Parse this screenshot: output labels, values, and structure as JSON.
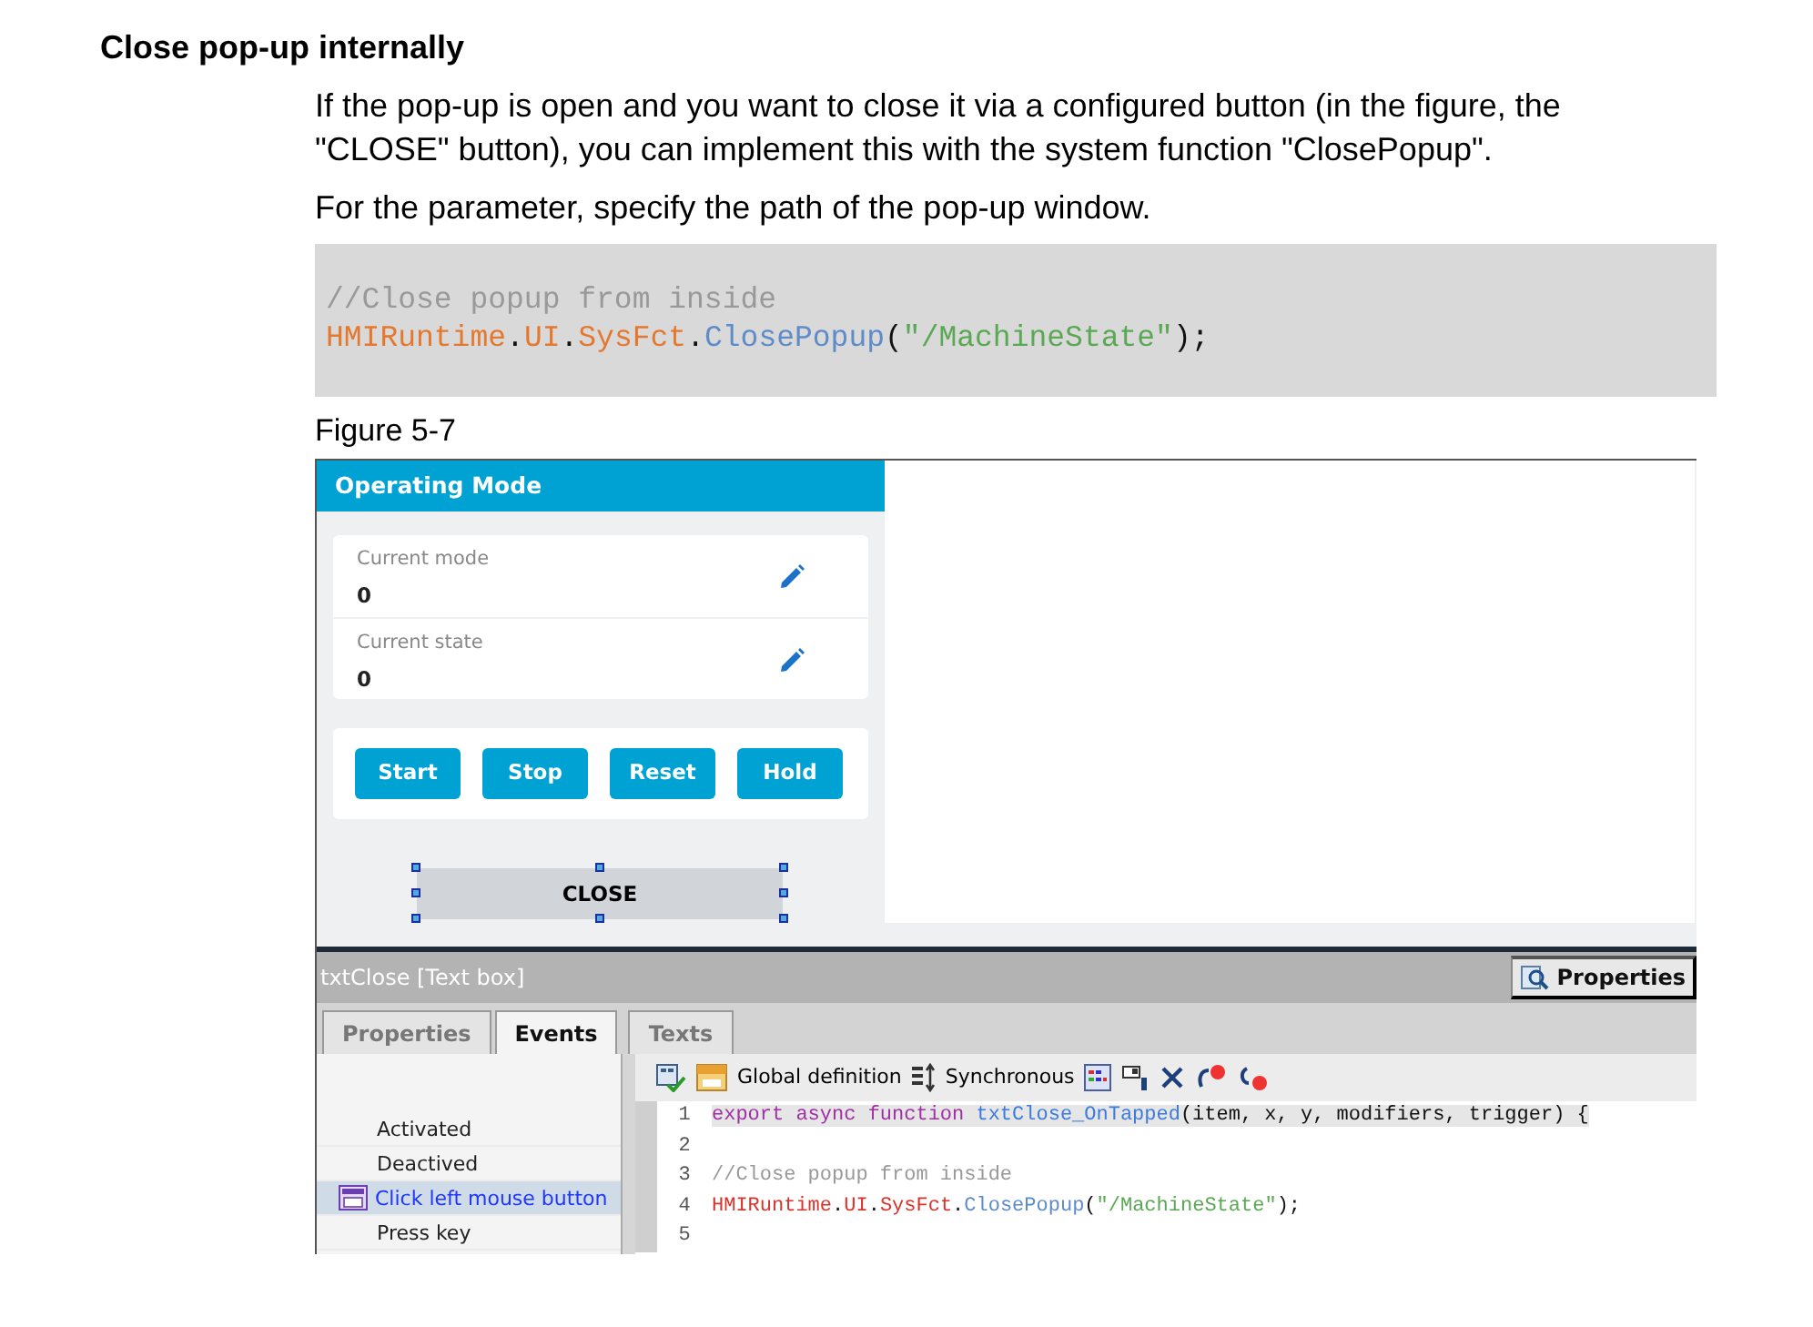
{
  "heading": "Close pop-up internally",
  "paragraphs": [
    "If the pop-up is open and you want to close it via a configured button (in the figure, the \"CLOSE\" button), you can implement this with the system function \"ClosePopup\".",
    "For the parameter, specify the path of the pop-up window."
  ],
  "code_block": [
    [
      {
        "text": "//Close popup from inside",
        "kind": "comment"
      }
    ],
    [
      {
        "text": "HMIRuntime",
        "kind": "ident"
      },
      {
        "text": ".",
        "kind": "plain"
      },
      {
        "text": "UI",
        "kind": "ident"
      },
      {
        "text": ".",
        "kind": "plain"
      },
      {
        "text": "SysFct",
        "kind": "ident"
      },
      {
        "text": ".",
        "kind": "plain"
      },
      {
        "text": "ClosePopup",
        "kind": "method"
      },
      {
        "text": "(",
        "kind": "plain"
      },
      {
        "text": "\"/MachineState\"",
        "kind": "string"
      },
      {
        "text": ");",
        "kind": "plain"
      }
    ]
  ],
  "figure_caption": "Figure 5-7",
  "popup": {
    "title": "Operating Mode",
    "fields": [
      {
        "label": "Current mode",
        "value": "0"
      },
      {
        "label": "Current state",
        "value": "0"
      }
    ],
    "buttons": [
      "Start",
      "Stop",
      "Reset",
      "Hold"
    ],
    "textbox": {
      "text": "CLOSE",
      "selected": true
    }
  },
  "inspector": {
    "title": "txtClose [Text box]",
    "properties_button": "Properties",
    "tabs": [
      {
        "label": "Properties",
        "selected": false
      },
      {
        "label": "Events",
        "selected": true
      },
      {
        "label": "Texts",
        "selected": false
      }
    ],
    "events": [
      {
        "label": "Activated",
        "selected": false
      },
      {
        "label": "Deactived",
        "selected": false
      },
      {
        "label": "Click left mouse button",
        "selected": true
      },
      {
        "label": "Press key",
        "selected": false
      }
    ],
    "toolbar": [
      "Global definition",
      "Synchronous"
    ],
    "code_lines": [
      {
        "number": "1",
        "highlighted": true,
        "tokens": [
          {
            "text": "export async function ",
            "kind": "keyword"
          },
          {
            "text": "txtClose_OnTapped",
            "kind": "func"
          },
          {
            "text": "(item, x, y, modifiers, trigger) {",
            "kind": "plain"
          }
        ]
      },
      {
        "number": "2",
        "highlighted": false
      },
      {
        "number": "3",
        "highlighted": false,
        "tokens": [
          {
            "text": "//Close popup from inside",
            "kind": "comment"
          }
        ]
      },
      {
        "number": "4",
        "highlighted": false,
        "tokens": [
          {
            "text": "HMIRuntime",
            "kind": "ident"
          },
          {
            "text": ".",
            "kind": "plain"
          },
          {
            "text": "UI",
            "kind": "ident"
          },
          {
            "text": ".",
            "kind": "plain"
          },
          {
            "text": "SysFct",
            "kind": "ident"
          },
          {
            "text": ".",
            "kind": "plain"
          },
          {
            "text": "ClosePopup",
            "kind": "method"
          },
          {
            "text": "(",
            "kind": "plain"
          },
          {
            "text": "\"/MachineState\"",
            "kind": "string"
          },
          {
            "text": ");",
            "kind": "plain"
          }
        ]
      },
      {
        "number": "5",
        "highlighted": false
      }
    ]
  }
}
